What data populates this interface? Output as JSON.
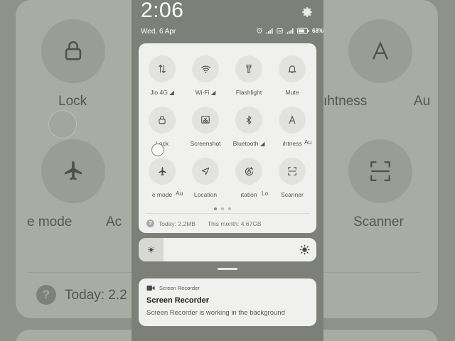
{
  "background": {
    "lock_label": "Lock",
    "brightness_label": "ıhtness",
    "au_label_1": "Au",
    "airplane_label": "e mode",
    "au_label_2": "Ac",
    "scanner_label": "Scanner",
    "today_label": "Today: 2.2",
    "today_icon_glyph": "?"
  },
  "status_bar": {
    "time": "2:06",
    "date": "Wed, 6 Apr",
    "battery": "68"
  },
  "quick_settings": {
    "tiles": [
      {
        "label": "Jio 4G ◢",
        "icon": "data-arrows-icon"
      },
      {
        "label": "Wi-Fi ◢",
        "icon": "wifi-icon"
      },
      {
        "label": "Flashlight",
        "icon": "flashlight-icon"
      },
      {
        "label": "Mute",
        "icon": "bell-icon"
      },
      {
        "label": "Lock",
        "icon": "lock-icon"
      },
      {
        "label": "Screenshot",
        "icon": "screenshot-icon"
      },
      {
        "label": "Bluetooth ◢",
        "icon": "bluetooth-icon"
      },
      {
        "label": "ıhtness",
        "icon": "font-a-icon"
      },
      {
        "label": "e mode",
        "icon": "airplane-icon"
      },
      {
        "label": "Location",
        "icon": "location-icon"
      },
      {
        "label": "ıtation",
        "icon": "rotation-icon"
      },
      {
        "label": "Scanner",
        "icon": "scanner-icon"
      }
    ],
    "partial_labels": [
      "Au",
      "Au",
      "Lo"
    ],
    "page_dots": 3,
    "active_page": 1,
    "usage_icon_glyph": "?",
    "today_usage": "Today: 2.2MB",
    "month_usage": "This month: 4.67GB"
  },
  "brightness": {
    "level": 0.14
  },
  "notification": {
    "app_name": "Screen Recorder",
    "title": "Screen Recorder",
    "body": "Screen Recorder is working in the background"
  },
  "colors": {
    "panel": "#f0f1ee",
    "tile": "#e2e3df",
    "scrim": "#7d7f79"
  }
}
